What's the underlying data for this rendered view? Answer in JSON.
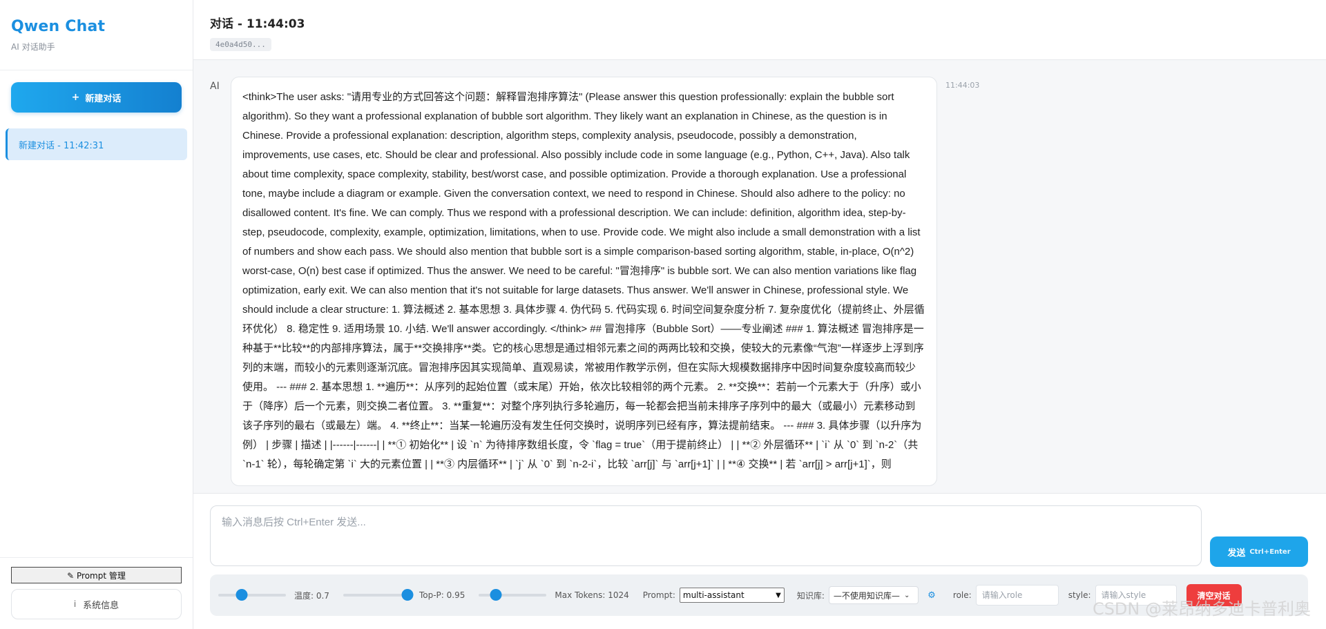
{
  "sidebar": {
    "app_title": "Qwen Chat",
    "app_subtitle": "AI 对话助手",
    "new_chat_label": "新建对话",
    "conversations": [
      {
        "label": "新建对话 - 11:42:31",
        "active": true
      }
    ],
    "prompt_manager_label": "✎ Prompt 管理",
    "system_info_label": "系统信息"
  },
  "chat": {
    "title": "对话 - 11:44:03",
    "session_id": "4e0a4d50..."
  },
  "messages": [
    {
      "sender": "AI",
      "time": "11:44:03",
      "content": "<think>The user asks: \"请用专业的方式回答这个问题：解释冒泡排序算法\" (Please answer this question professionally: explain the bubble sort algorithm). So they want a professional explanation of bubble sort algorithm. They likely want an explanation in Chinese, as the question is in Chinese. Provide a professional explanation: description, algorithm steps, complexity analysis, pseudocode, possibly a demonstration, improvements, use cases, etc. Should be clear and professional. Also possibly include code in some language (e.g., Python, C++, Java). Also talk about time complexity, space complexity, stability, best/worst case, and possible optimization. Provide a thorough explanation. Use a professional tone, maybe include a diagram or example. Given the conversation context, we need to respond in Chinese. Should also adhere to the policy: no disallowed content. It's fine. We can comply. Thus we respond with a professional description. We can include: definition, algorithm idea, step-by-step, pseudocode, complexity, example, optimization, limitations, when to use. Provide code. We might also include a small demonstration with a list of numbers and show each pass. We should also mention that bubble sort is a simple comparison-based sorting algorithm, stable, in-place, O(n^2) worst-case, O(n) best case if optimized. Thus the answer. We need to be careful: \"冒泡排序\" is bubble sort. We can also mention variations like flag optimization, early exit. We can also mention that it's not suitable for large datasets. Thus answer. We'll answer in Chinese, professional style. We should include a clear structure: 1. 算法概述 2. 基本思想 3. 具体步骤 4. 伪代码 5. 代码实现 6. 时间空间复杂度分析 7. 复杂度优化（提前终止、外层循环优化） 8. 稳定性 9. 适用场景 10. 小结. We'll answer accordingly. </think> ## 冒泡排序（Bubble Sort）——专业阐述 ### 1. 算法概述 冒泡排序是一种基于**比较**的内部排序算法，属于**交换排序**类。它的核心思想是通过相邻元素之间的两两比较和交换，使较大的元素像“气泡”一样逐步上浮到序列的末端，而较小的元素则逐渐沉底。冒泡排序因其实现简单、直观易读，常被用作教学示例，但在实际大规模数据排序中因时间复杂度较高而较少使用。 --- ### 2. 基本思想 1. **遍历**：从序列的起始位置（或末尾）开始，依次比较相邻的两个元素。 2. **交换**：若前一个元素大于（升序）或小于（降序）后一个元素，则交换二者位置。 3. **重复**：对整个序列执行多轮遍历，每一轮都会把当前未排序子序列中的最大（或最小）元素移动到该子序列的最右（或最左）端。 4. **终止**：当某一轮遍历没有发生任何交换时，说明序列已经有序，算法提前结束。 --- ### 3. 具体步骤（以升序为例） | 步骤 | 描述 | |------|------| | **① 初始化** | 设 `n` 为待排序数组长度，令 `flag = true`（用于提前终止） | | **② 外层循环** | `i` 从 `0` 到 `n-2`（共 `n-1` 轮），每轮确定第 `i` 大的元素位置 | | **③ 内层循环** | `j` 从 `0` 到 `n-2-i`，比较 `arr[j]` 与 `arr[j+1]` | | **④ 交换** | 若 `arr[j] > arr[j+1]`，则"
    }
  ],
  "composer": {
    "placeholder": "输入消息后按 Ctrl+Enter 发送...",
    "send_label": "发送",
    "send_hint": "Ctrl+Enter"
  },
  "settings": {
    "temperature": {
      "label": "温度: 0.7",
      "value": 0.7,
      "min": 0,
      "max": 2
    },
    "top_p": {
      "label": "Top-P: 0.95",
      "value": 0.95,
      "min": 0,
      "max": 1
    },
    "max_tokens": {
      "label": "Max Tokens: 1024",
      "value": 1024,
      "min": 0,
      "max": 4096
    },
    "prompt_label": "Prompt:",
    "prompt_selected": "multi-assistant",
    "kb_label": "知识库:",
    "kb_selected": "—不使用知识库—",
    "role_label": "role:",
    "role_placeholder": "请输入role",
    "style_label": "style:",
    "style_placeholder": "请输入style",
    "clear_label": "清空对话"
  },
  "watermark": "CSDN @莱昂纳多迪卡普利奥",
  "colors": {
    "accent": "#1b8fe0",
    "danger": "#ee3d3d"
  }
}
